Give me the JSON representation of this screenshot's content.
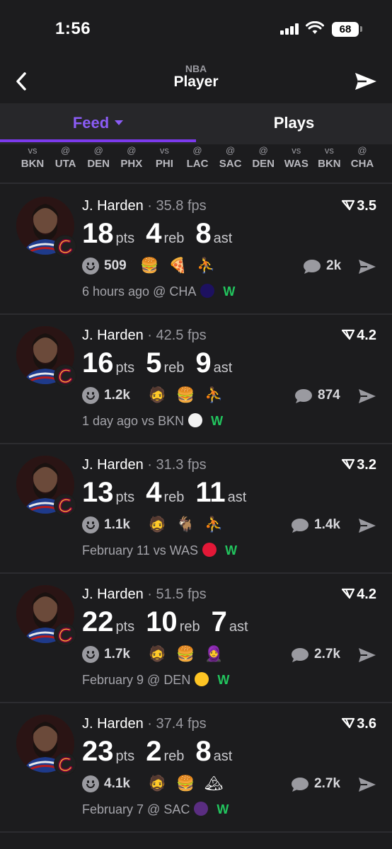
{
  "status_bar": {
    "time": "1:56",
    "battery": "68"
  },
  "header": {
    "league": "NBA",
    "title": "Player"
  },
  "tabs": [
    {
      "label": "Feed"
    },
    {
      "label": "Plays"
    }
  ],
  "schedule": [
    {
      "prefix": "vs",
      "team": "BKN"
    },
    {
      "prefix": "@",
      "team": "UTA"
    },
    {
      "prefix": "@",
      "team": "DEN"
    },
    {
      "prefix": "@",
      "team": "PHX"
    },
    {
      "prefix": "vs",
      "team": "PHI"
    },
    {
      "prefix": "@",
      "team": "LAC"
    },
    {
      "prefix": "@",
      "team": "SAC"
    },
    {
      "prefix": "@",
      "team": "DEN"
    },
    {
      "prefix": "vs",
      "team": "WAS"
    },
    {
      "prefix": "vs",
      "team": "BKN"
    },
    {
      "prefix": "@",
      "team": "CHA"
    }
  ],
  "games": [
    {
      "player": "J. Harden",
      "fps": "35.8 fps",
      "pts": "18",
      "reb": "4",
      "ast": "8",
      "rating": "3.5",
      "reactions": "509",
      "emojis": [
        "🍔",
        "🍕",
        "⛹"
      ],
      "comments": "2k",
      "when": "6 hours ago @ CHA",
      "result": "W",
      "logo_color": "#1d1160"
    },
    {
      "player": "J. Harden",
      "fps": "42.5 fps",
      "pts": "16",
      "reb": "5",
      "ast": "9",
      "rating": "4.2",
      "reactions": "1.2k",
      "emojis": [
        "🧔",
        "🍔",
        "⛹"
      ],
      "comments": "874",
      "when": "1 day ago vs BKN",
      "result": "W",
      "logo_color": "#f2f2f2"
    },
    {
      "player": "J. Harden",
      "fps": "31.3 fps",
      "pts": "13",
      "reb": "4",
      "ast": "11",
      "rating": "3.2",
      "reactions": "1.1k",
      "emojis": [
        "🧔",
        "🐐",
        "⛹"
      ],
      "comments": "1.4k",
      "when": "February 11 vs WAS",
      "result": "W",
      "logo_color": "#e31837"
    },
    {
      "player": "J. Harden",
      "fps": "51.5 fps",
      "pts": "22",
      "reb": "10",
      "ast": "7",
      "rating": "4.2",
      "reactions": "1.7k",
      "emojis": [
        "🧔",
        "🍔",
        "🧕"
      ],
      "comments": "2.7k",
      "when": "February 9 @ DEN",
      "result": "W",
      "logo_color": "#fec524"
    },
    {
      "player": "J. Harden",
      "fps": "37.4 fps",
      "pts": "23",
      "reb": "2",
      "ast": "8",
      "rating": "3.6",
      "reactions": "4.1k",
      "emojis": [
        "🧔",
        "🍔",
        "🏔"
      ],
      "comments": "2.7k",
      "when": "February 7 @ SAC",
      "result": "W",
      "logo_color": "#5a2d81"
    }
  ],
  "units": {
    "pts": "pts",
    "reb": "reb",
    "ast": "ast"
  },
  "colors": {
    "accent": "#8b5cf6",
    "win": "#22c55e",
    "background": "#1c1c1e"
  }
}
